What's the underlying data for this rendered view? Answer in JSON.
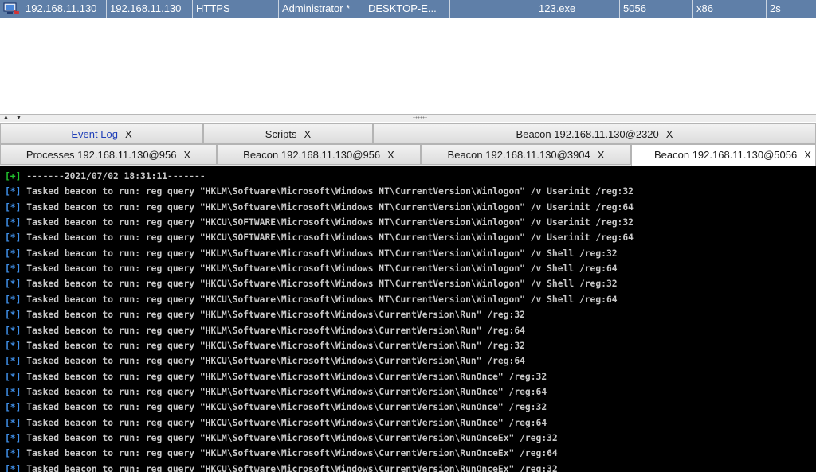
{
  "session": {
    "external_ip": "192.168.11.130",
    "internal_ip": "192.168.11.130",
    "listener": "HTTPS",
    "user": "Administrator *",
    "computer": "DESKTOP-E...",
    "note": "",
    "process": "123.exe",
    "pid": "5056",
    "arch": "x86",
    "last": "2s"
  },
  "tabs_row1": [
    {
      "label": "Event Log",
      "close": "X"
    },
    {
      "label": "Scripts",
      "close": "X"
    },
    {
      "label": "Beacon 192.168.11.130@2320",
      "close": "X"
    }
  ],
  "tabs_row2": [
    {
      "label": "Processes 192.168.11.130@956",
      "close": "X"
    },
    {
      "label": "Beacon 192.168.11.130@956",
      "close": "X"
    },
    {
      "label": "Beacon 192.168.11.130@3904",
      "close": "X"
    },
    {
      "label": "Beacon 192.168.11.130@5056",
      "close": "X"
    }
  ],
  "console": {
    "lines": [
      {
        "prefix": "[+]",
        "text": " -------2021/07/02 18:31:11-------"
      },
      {
        "prefix": "[*]",
        "text": " Tasked beacon to run: reg query \"HKLM\\Software\\Microsoft\\Windows NT\\CurrentVersion\\Winlogon\" /v Userinit /reg:32"
      },
      {
        "prefix": "[*]",
        "text": " Tasked beacon to run: reg query \"HKLM\\Software\\Microsoft\\Windows NT\\CurrentVersion\\Winlogon\" /v Userinit /reg:64"
      },
      {
        "prefix": "[*]",
        "text": " Tasked beacon to run: reg query \"HKCU\\SOFTWARE\\Microsoft\\Windows NT\\CurrentVersion\\Winlogon\" /v Userinit /reg:32"
      },
      {
        "prefix": "[*]",
        "text": " Tasked beacon to run: reg query \"HKCU\\SOFTWARE\\Microsoft\\Windows NT\\CurrentVersion\\Winlogon\" /v Userinit /reg:64"
      },
      {
        "prefix": "[*]",
        "text": " Tasked beacon to run: reg query \"HKLM\\Software\\Microsoft\\Windows NT\\CurrentVersion\\Winlogon\" /v Shell /reg:32"
      },
      {
        "prefix": "[*]",
        "text": " Tasked beacon to run: reg query \"HKLM\\Software\\Microsoft\\Windows NT\\CurrentVersion\\Winlogon\" /v Shell /reg:64"
      },
      {
        "prefix": "[*]",
        "text": " Tasked beacon to run: reg query \"HKCU\\Software\\Microsoft\\Windows NT\\CurrentVersion\\Winlogon\" /v Shell /reg:32"
      },
      {
        "prefix": "[*]",
        "text": " Tasked beacon to run: reg query \"HKCU\\Software\\Microsoft\\Windows NT\\CurrentVersion\\Winlogon\" /v Shell /reg:64"
      },
      {
        "prefix": "[*]",
        "text": " Tasked beacon to run: reg query \"HKLM\\Software\\Microsoft\\Windows\\CurrentVersion\\Run\" /reg:32"
      },
      {
        "prefix": "[*]",
        "text": " Tasked beacon to run: reg query \"HKLM\\Software\\Microsoft\\Windows\\CurrentVersion\\Run\" /reg:64"
      },
      {
        "prefix": "[*]",
        "text": " Tasked beacon to run: reg query \"HKCU\\Software\\Microsoft\\Windows\\CurrentVersion\\Run\" /reg:32"
      },
      {
        "prefix": "[*]",
        "text": " Tasked beacon to run: reg query \"HKCU\\Software\\Microsoft\\Windows\\CurrentVersion\\Run\" /reg:64"
      },
      {
        "prefix": "[*]",
        "text": " Tasked beacon to run: reg query \"HKLM\\Software\\Microsoft\\Windows\\CurrentVersion\\RunOnce\" /reg:32"
      },
      {
        "prefix": "[*]",
        "text": " Tasked beacon to run: reg query \"HKLM\\Software\\Microsoft\\Windows\\CurrentVersion\\RunOnce\" /reg:64"
      },
      {
        "prefix": "[*]",
        "text": " Tasked beacon to run: reg query \"HKCU\\Software\\Microsoft\\Windows\\CurrentVersion\\RunOnce\" /reg:32"
      },
      {
        "prefix": "[*]",
        "text": " Tasked beacon to run: reg query \"HKCU\\Software\\Microsoft\\Windows\\CurrentVersion\\RunOnce\" /reg:64"
      },
      {
        "prefix": "[*]",
        "text": " Tasked beacon to run: reg query \"HKLM\\Software\\Microsoft\\Windows\\CurrentVersion\\RunOnceEx\" /reg:32"
      },
      {
        "prefix": "[*]",
        "text": " Tasked beacon to run: reg query \"HKLM\\Software\\Microsoft\\Windows\\CurrentVersion\\RunOnceEx\" /reg:64"
      },
      {
        "prefix": "[*]",
        "text": " Tasked beacon to run: reg query \"HKCU\\Software\\Microsoft\\Windows\\CurrentVersion\\RunOnceEx\" /reg:32"
      }
    ]
  },
  "colors": {
    "selected_row": "#5f7fa8",
    "console_bg": "#000000",
    "prefix_plus": "#22c22e",
    "prefix_star": "#3f8fe8",
    "event_log_tab": "#1f3fb8"
  },
  "icons": {
    "host": "computer-monitor-icon",
    "split_up": "triangle-up-icon",
    "split_down": "triangle-down-icon"
  }
}
